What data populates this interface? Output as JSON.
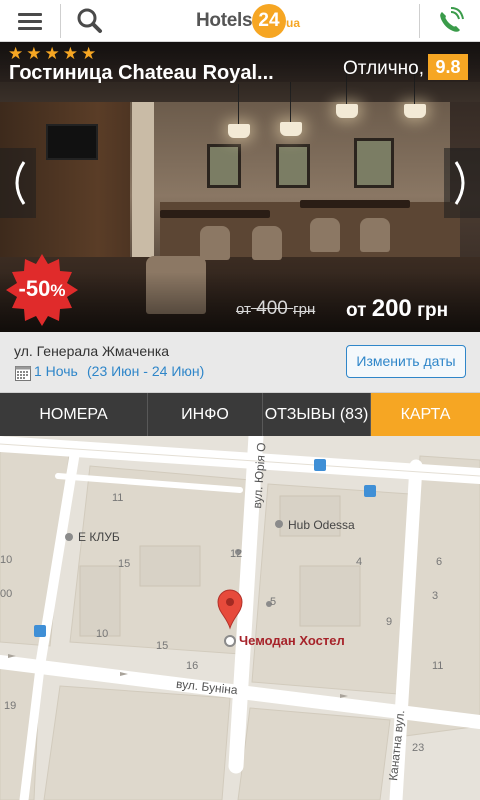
{
  "header": {
    "logo_text": "Hotels",
    "logo_number": "24",
    "logo_suffix": "ua",
    "colors": {
      "brand_orange": "#f6a623",
      "phone_green": "#3a9b4a"
    }
  },
  "hotel": {
    "stars": "★★★★★",
    "name": "Гостиница Chateau Royal...",
    "rating_label": "Отлично,",
    "rating_value": "9.8",
    "discount_value": "-50",
    "discount_percent": "%",
    "old_price_prefix": "от",
    "old_price_value": "400",
    "old_price_unit": "грн",
    "new_price_prefix": "от",
    "new_price_value": "200",
    "new_price_unit": "грн"
  },
  "booking": {
    "address": "ул. Генерала Жмаченка",
    "nights": "1 Ночь",
    "dates": "(23 Июн - 24 Июн)",
    "change_dates_label": "Изменить даты"
  },
  "tabs": [
    {
      "label": "НОМЕРА"
    },
    {
      "label": "ИНФО"
    },
    {
      "label": "ОТЗЫВЫ (83)"
    },
    {
      "label": "КАРТА",
      "active": true
    }
  ],
  "map": {
    "streets": [
      "вул. Юрія О",
      "вул. Буніна",
      "Канатна вул."
    ],
    "pois": [
      "Е КЛУБ",
      "Hub Odessa"
    ],
    "marker_label": "Чемодан Хостел",
    "building_numbers": [
      "11",
      "15",
      "10",
      "00",
      "4",
      "6",
      "5",
      "9",
      "3",
      "11",
      "12",
      "10",
      "15",
      "16",
      "19",
      "23"
    ]
  }
}
